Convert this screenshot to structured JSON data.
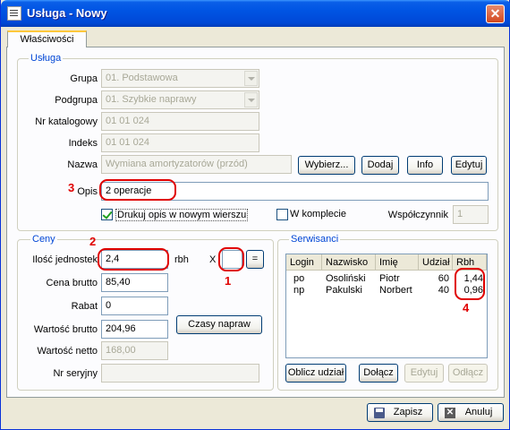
{
  "window": {
    "title": "Usługa - Nowy",
    "close_glyph": "✕"
  },
  "tab": {
    "label": "Właściwości"
  },
  "usluga": {
    "legend": "Usługa",
    "grupa_label": "Grupa",
    "grupa_value": "01. Podstawowa",
    "podgrupa_label": "Podgrupa",
    "podgrupa_value": "01. Szybkie naprawy",
    "nrkat_label": "Nr katalogowy",
    "nrkat_value": "01 01 024",
    "indeks_label": "Indeks",
    "indeks_value": "01 01 024",
    "nazwa_label": "Nazwa",
    "nazwa_value": "Wymiana amortyzatorów (przód)",
    "btn_wybierz": "Wybierz...",
    "btn_dodaj": "Dodaj",
    "btn_info": "Info",
    "btn_edytuj": "Edytuj",
    "opis_label": "Opis",
    "opis_value": "2 operacje",
    "drukuj_label": "Drukuj opis w nowym wierszu",
    "drukuj_checked": true,
    "wkomplecie_label": "W komplecie",
    "wkomplecie_checked": false,
    "wspolczynnik_label": "Współczynnik",
    "wspolczynnik_value": "1"
  },
  "ceny": {
    "legend": "Ceny",
    "ilosc_label": "Ilość jednostek",
    "ilosc_value": "2,4",
    "ilosc_unit": "rbh",
    "x_label": "X",
    "x_value": "",
    "eq_button": "=",
    "cena_label": "Cena brutto",
    "cena_value": "85,40",
    "rabat_label": "Rabat",
    "rabat_value": "0",
    "wbrutto_label": "Wartość brutto",
    "wbrutto_value": "204,96",
    "btn_czasy": "Czasy napraw",
    "wnetto_label": "Wartość netto",
    "wnetto_value": "168,00",
    "nrser_label": "Nr seryjny",
    "nrser_value": ""
  },
  "serwisanci": {
    "legend": "Serwisanci",
    "columns": [
      "Login",
      "Nazwisko",
      "Imię",
      "Udział",
      "Rbh"
    ],
    "rows": [
      [
        "po",
        "Osoliński",
        "Piotr",
        "60",
        "1,44"
      ],
      [
        "np",
        "Pakulski",
        "Norbert",
        "40",
        "0,96"
      ]
    ],
    "btn_oblicz": "Oblicz udział",
    "btn_dolacz": "Dołącz",
    "btn_edytuj": "Edytuj",
    "btn_odlacz": "Odłącz"
  },
  "footer": {
    "btn_zapisz": "Zapisz",
    "btn_anuluj": "Anuluj"
  },
  "annotations": {
    "n1": "1",
    "n2": "2",
    "n3": "3",
    "n4": "4"
  },
  "colors": {
    "annotation": "#E00000",
    "titlebar": "#0054E3",
    "legend": "#0046D5"
  }
}
